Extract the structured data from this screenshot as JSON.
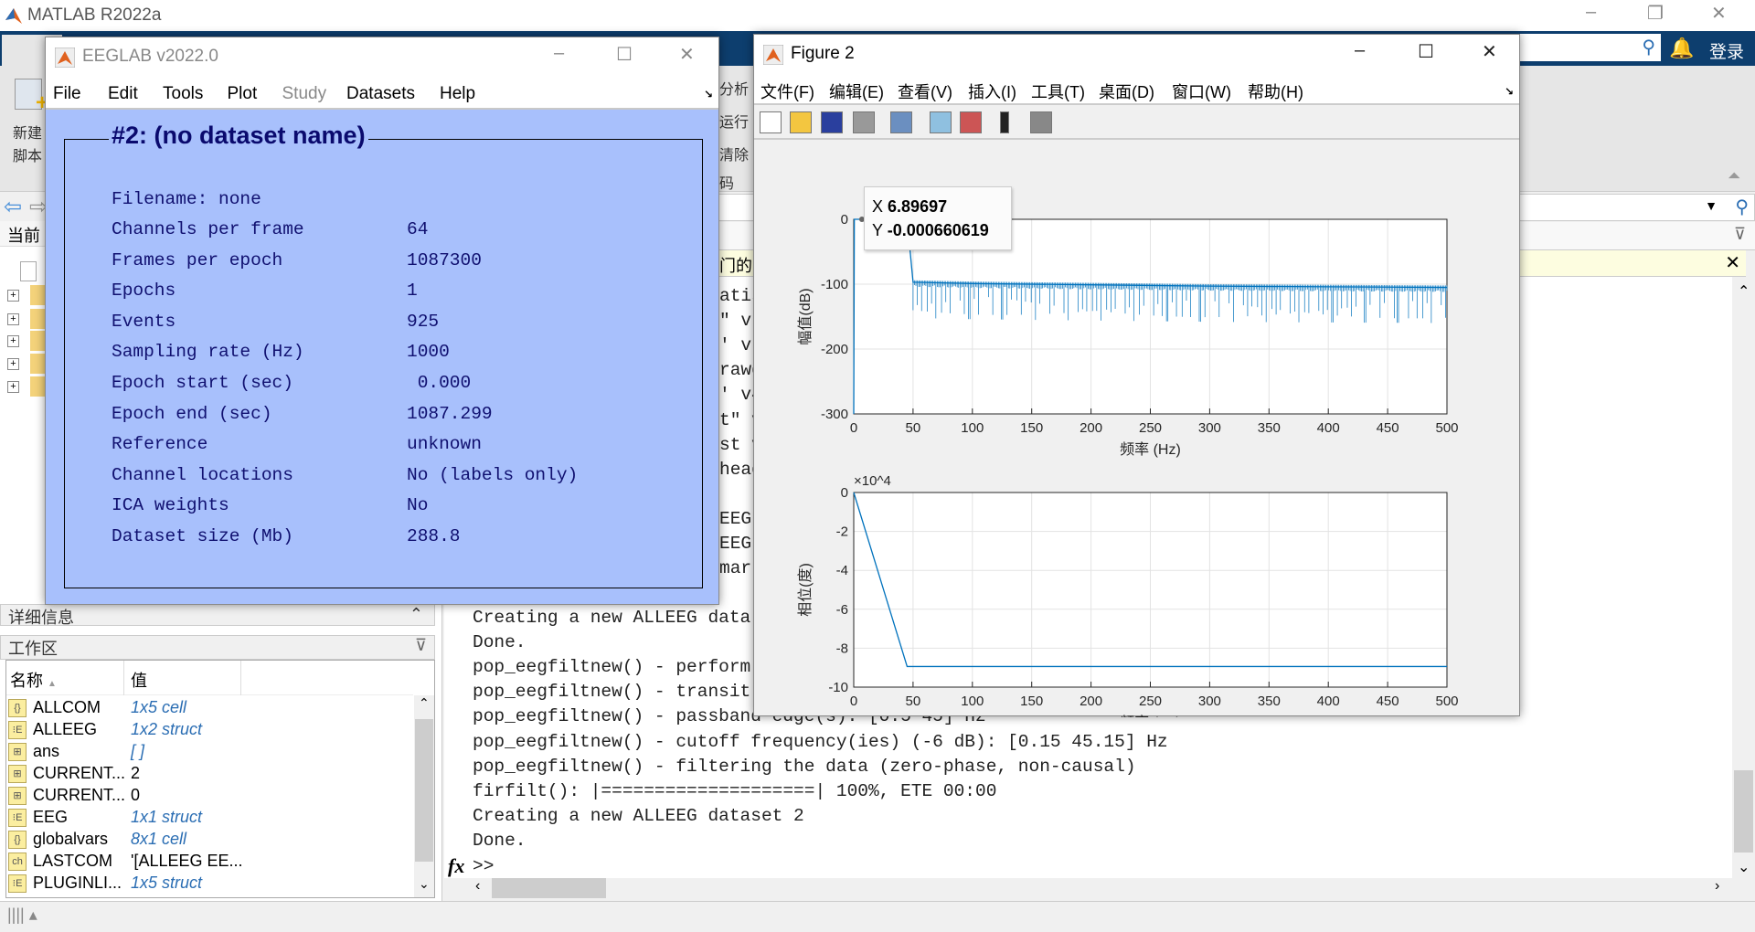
{
  "matlab": {
    "title": "MATLAB R2022a",
    "login": "登录",
    "toolstrip": {
      "new_script": [
        "新建",
        "脚本"
      ],
      "partial_labels": [
        "分析",
        "运行",
        "清除",
        "码"
      ]
    },
    "current_folder_header": "当前",
    "yellow_bar_fragment": "门的"
  },
  "left": {
    "details_header": "详细信息",
    "workspace_header": "工作区",
    "columns": [
      "名称",
      "值"
    ],
    "variables": [
      {
        "name": "ALLCOM",
        "value": "1x5 cell",
        "icon": "cell-icon",
        "italic": true
      },
      {
        "name": "ALLEEG",
        "value": "1x2 struct",
        "icon": "struct-icon",
        "italic": true
      },
      {
        "name": "ans",
        "value": "[ ]",
        "icon": "matrix-icon",
        "italic": true
      },
      {
        "name": "CURRENT...",
        "value": "2",
        "icon": "matrix-icon",
        "italic": false
      },
      {
        "name": "CURRENT...",
        "value": "0",
        "icon": "matrix-icon",
        "italic": false
      },
      {
        "name": "EEG",
        "value": "1x1 struct",
        "icon": "struct-icon",
        "italic": true
      },
      {
        "name": "globalvars",
        "value": "8x1 cell",
        "icon": "cell-icon",
        "italic": true
      },
      {
        "name": "LASTCOM",
        "value": "'[ALLEEG EE...",
        "icon": "char-icon",
        "italic": false
      },
      {
        "name": "PLUGINLI...",
        "value": "1x5 struct",
        "icon": "struct-icon",
        "italic": true
      }
    ]
  },
  "console": {
    "fragments": [
      "atis",
      "\" v",
      "' vl",
      "rawd",
      "' v4",
      "t\" v",
      "st v",
      "head",
      "",
      "EEG",
      "EEG",
      "mark"
    ],
    "lines": [
      "Creating a new ALLEEG data",
      "Done.",
      "pop_eegfiltnew() - perform",
      "pop_eegfiltnew() - transit",
      "pop_eegfiltnew() - passband edge(s): [0.5 45] Hz",
      "pop_eegfiltnew() - cutoff frequency(ies) (-6 dB): [0.15 45.15] Hz",
      "pop_eegfiltnew() - filtering the data (zero-phase, non-causal)",
      "firfilt(): |====================| 100%, ETE 00:00",
      "Creating a new ALLEEG dataset 2",
      "Done."
    ],
    "prompt": ">>"
  },
  "eeglab": {
    "title": "EEGLAB v2022.0",
    "menu": [
      "File",
      "Edit",
      "Tools",
      "Plot",
      "Study",
      "Datasets",
      "Help"
    ],
    "disabled_menu": "Study",
    "dataset_title": "#2: (no dataset name)",
    "filename": "Filename: none",
    "info": [
      [
        "Channels per frame",
        "64"
      ],
      [
        "Frames per epoch",
        "1087300"
      ],
      [
        "Epochs",
        "1"
      ],
      [
        "Events",
        "925"
      ],
      [
        "Sampling rate (Hz)",
        "1000"
      ],
      [
        "Epoch start (sec)",
        " 0.000"
      ],
      [
        "Epoch end (sec)",
        "1087.299"
      ],
      [
        "Reference",
        "unknown"
      ],
      [
        "Channel locations",
        "No (labels only)"
      ],
      [
        "ICA weights",
        "No"
      ],
      [
        "Dataset size (Mb)",
        "288.8"
      ]
    ],
    "background": "#a8c0fc"
  },
  "figure": {
    "title": "Figure 2",
    "menu": [
      "文件(F)",
      "编辑(E)",
      "查看(V)",
      "插入(I)",
      "工具(T)",
      "桌面(D)",
      "窗口(W)",
      "帮助(H)"
    ],
    "toolbar": [
      "new-figure-icon",
      "open-icon",
      "save-icon",
      "print-icon",
      "link-icon",
      "colorbar-icon",
      "legend-icon",
      "pointer-icon",
      "property-editor-icon"
    ],
    "datatip": {
      "x_label": "X",
      "x_value": "6.89697",
      "y_label": "Y",
      "y_value": "-0.000660619"
    }
  },
  "chart_data": [
    {
      "type": "line",
      "title": "",
      "xlabel": "频率 (Hz)",
      "ylabel": "幅值(dB)",
      "xlim": [
        0,
        500
      ],
      "ylim": [
        -300,
        0
      ],
      "xticks": [
        0,
        50,
        100,
        150,
        200,
        250,
        300,
        350,
        400,
        450,
        500
      ],
      "yticks": [
        0,
        -100,
        -200,
        -300
      ],
      "grid": true,
      "color": "#0072bd",
      "x": [
        0,
        0.5,
        45,
        50,
        100,
        200,
        300,
        400,
        500
      ],
      "y": [
        -300,
        0,
        0,
        -97,
        -99,
        -101,
        -103,
        -104,
        -105
      ],
      "stopband_ripple_min_db": -165
    },
    {
      "type": "line",
      "title": "",
      "xlabel": "频率 (Hz)",
      "ylabel": "相位(度)",
      "xlim": [
        0,
        500
      ],
      "ylim": [
        -10,
        0
      ],
      "y_multiplier": "×10^4",
      "xticks": [
        0,
        50,
        100,
        150,
        200,
        250,
        300,
        350,
        400,
        450,
        500
      ],
      "yticks": [
        0,
        -2,
        -4,
        -6,
        -8,
        -10
      ],
      "grid": true,
      "color": "#0072bd",
      "x": [
        0,
        45,
        500
      ],
      "y": [
        0,
        -8.94,
        -8.94
      ]
    }
  ]
}
